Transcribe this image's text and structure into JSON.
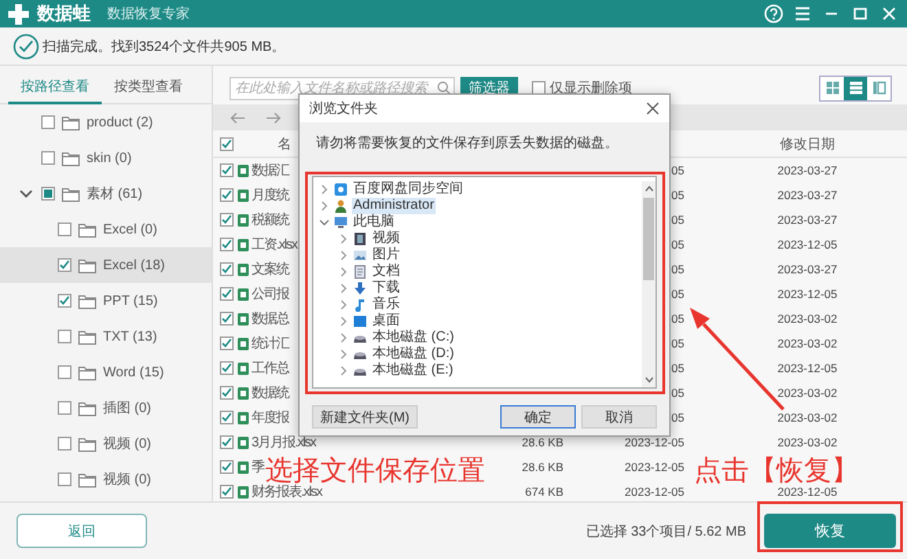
{
  "window": {
    "app_name": "数据蛙",
    "subtitle": "数据恢复专家"
  },
  "scan_status": "扫描完成。找到3524个文件共905 MB。",
  "view_tabs": [
    {
      "label": "按路径查看",
      "selected": true
    },
    {
      "label": "按类型查看",
      "selected": false
    }
  ],
  "folder_tree": [
    {
      "label": "product (2)",
      "checked": false,
      "indeterminate": false,
      "selected": false
    },
    {
      "label": "skin (0)",
      "checked": false,
      "indeterminate": false,
      "selected": false
    },
    {
      "label": "素材 (61)",
      "checked": false,
      "indeterminate": true,
      "selected": false,
      "expanded": true,
      "children": [
        {
          "label": "Excel (0)",
          "checked": false,
          "indeterminate": false,
          "selected": false
        },
        {
          "label": "Excel (18)",
          "checked": true,
          "indeterminate": false,
          "selected": true
        },
        {
          "label": "PPT (15)",
          "checked": true,
          "indeterminate": false,
          "selected": false
        },
        {
          "label": "TXT (13)",
          "checked": false,
          "indeterminate": false,
          "selected": false
        },
        {
          "label": "Word (15)",
          "checked": false,
          "indeterminate": false,
          "selected": false
        },
        {
          "label": "插图 (0)",
          "checked": false,
          "indeterminate": false,
          "selected": false
        },
        {
          "label": "视频 (0)",
          "checked": false,
          "indeterminate": false,
          "selected": false
        },
        {
          "label": "视频 (0)",
          "checked": false,
          "indeterminate": false,
          "selected": false
        }
      ]
    }
  ],
  "search": {
    "placeholder": "在此处输入文件名称或路径搜索"
  },
  "filter_button": "筛选器",
  "deleted_only": {
    "label": "仅显示删除项",
    "checked": false
  },
  "view_modes": [
    {
      "kind": "grid",
      "selected": false
    },
    {
      "kind": "list",
      "selected": true
    },
    {
      "kind": "columns",
      "selected": false
    }
  ],
  "file_table": {
    "all_checked": true,
    "columns": [
      "名",
      "修改日期"
    ],
    "rows": [
      {
        "checked": true,
        "name": "数据汇",
        "column_4": "05",
        "modified": "2023-03-27"
      },
      {
        "checked": true,
        "name": "月度统",
        "column_4": "05",
        "modified": "2023-03-27"
      },
      {
        "checked": true,
        "name": "税额统",
        "column_4": "05",
        "modified": "2023-03-27"
      },
      {
        "checked": true,
        "name": "工资.xlsx",
        "column_4": "05",
        "modified": "2023-12-05"
      },
      {
        "checked": true,
        "name": "文案统",
        "column_4": "05",
        "modified": "2023-03-27"
      },
      {
        "checked": true,
        "name": "公司报",
        "column_4": "05",
        "modified": "2023-12-05"
      },
      {
        "checked": true,
        "name": "数据总",
        "column_4": "05",
        "modified": "2023-03-02"
      },
      {
        "checked": true,
        "name": "统计汇",
        "column_4": "05",
        "modified": "2023-03-02"
      },
      {
        "checked": true,
        "name": "工作总",
        "column_4": "05",
        "modified": "2023-12-05"
      },
      {
        "checked": true,
        "name": "数据统",
        "column_4": "05",
        "modified": "2023-03-02"
      },
      {
        "checked": true,
        "name": "年度报",
        "column_4": "05",
        "modified": "2023-03-02"
      },
      {
        "checked": true,
        "name": "3月月报.xlsx",
        "column_3": "28.6 KB",
        "column_4": "2023-12-05",
        "modified": "2023-03-02"
      },
      {
        "checked": true,
        "name": "季",
        "column_3": "28.6 KB",
        "column_4": "2023-12-05"
      },
      {
        "checked": true,
        "name": "财务报表.xlsx",
        "column_3": "674 KB",
        "column_4": "2023-12-05",
        "modified": "2023-12-05"
      }
    ]
  },
  "dialog": {
    "title": "浏览文件夹",
    "message": "请勿将需要恢复的文件保存到原丢失数据的磁盘。",
    "tree": [
      {
        "label": "百度网盘同步空间",
        "kind": "cloud",
        "expanded": false,
        "selected": false
      },
      {
        "label": "Administrator",
        "kind": "user",
        "expanded": false,
        "selected": true
      },
      {
        "label": "此电脑",
        "kind": "pc",
        "expanded": true,
        "selected": false,
        "children": [
          {
            "label": "视频",
            "kind": "video",
            "expanded": false,
            "selected": false
          },
          {
            "label": "图片",
            "kind": "pictures",
            "expanded": false,
            "selected": false
          },
          {
            "label": "文档",
            "kind": "docs",
            "expanded": false,
            "selected": false
          },
          {
            "label": "下载",
            "kind": "download",
            "expanded": false,
            "selected": false
          },
          {
            "label": "音乐",
            "kind": "music",
            "expanded": false,
            "selected": false
          },
          {
            "label": "桌面",
            "kind": "desktop",
            "expanded": false,
            "selected": false
          },
          {
            "label": "本地磁盘 (C:)",
            "kind": "drive",
            "expanded": false,
            "selected": false
          },
          {
            "label": "本地磁盘 (D:)",
            "kind": "drive",
            "expanded": false,
            "selected": false
          },
          {
            "label": "本地磁盘 (E:)",
            "kind": "drive",
            "expanded": false,
            "selected": false
          }
        ]
      }
    ],
    "buttons": [
      {
        "label": "新建文件夹(M)",
        "kind": "plain"
      },
      {
        "label": "确定",
        "kind": "default"
      },
      {
        "label": "取消",
        "kind": "plain"
      }
    ]
  },
  "bottom_bar": {
    "back": "返回",
    "selection": "已选择 33个项目/ 5.62 MB",
    "recover": "恢复"
  },
  "annotations": [
    "选择文件保存位置",
    "点击【恢复】"
  ]
}
